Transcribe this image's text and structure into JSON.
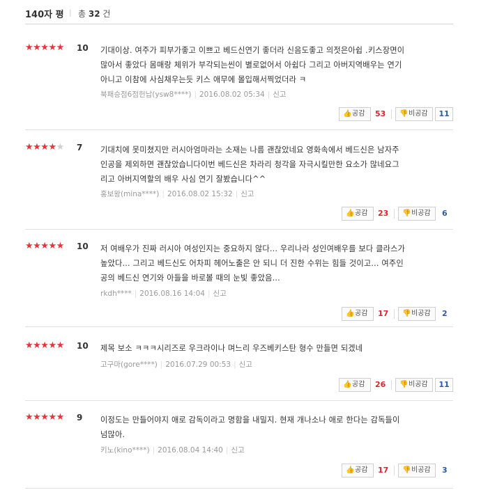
{
  "header": {
    "title": "140자 평",
    "separator": "|",
    "total_prefix": "총",
    "total_count": "32",
    "total_suffix": "건"
  },
  "labels": {
    "like": "공감",
    "dislike": "비공감",
    "report": "신고"
  },
  "reviews": [
    {
      "stars": 5,
      "score": "10",
      "lines": [
        "기대이상. 여주가 피부가좋고 이쁘고 베드신연기 좋더라 신음도좋고 의젓은아쉽 .키스장면이",
        "많아서 좋았다 몸매랑 체위가 부각되는씬이 별로없어서 아쉽다 그리고 아버지역배우는 연기",
        "아니고 이참에 사심채우는듯 키스 애무에 몰입해서찍었더라 ㅋ"
      ],
      "author": "북패승점6점헌납(ysw8****)",
      "date": "2016.08.02 05:34",
      "likes": "53",
      "dislikes": "11"
    },
    {
      "stars": 3.5,
      "score": "7",
      "lines": [
        "기대치에 못미쳤지만 러시아엄마라는 소재는 나름 괜찮았네요 영화속에서 베드신은 남자주",
        "인공을 제외하면 괜찮았습니다이번 베드신은 차라리 청각을 자극시킬만한 요소가 많네요그",
        "리고 아버지역할의 배우 사심 연기 잘봤습니다^^"
      ],
      "author": "홍보왕(mina****)",
      "date": "2016.08.02 15:32",
      "likes": "23",
      "dislikes": "6"
    },
    {
      "stars": 5,
      "score": "10",
      "lines": [
        "저 여배우가 진짜 러시아 여성인지는 중요하지 않다... 우리나라 성인여배우를 보다 클라스가",
        "높았다... 그리고 베드신도 어차피 헤어노출은 안 되니 더 진한 수위는 힘들 것이고... 여주인",
        "공의 베드신 연기와 아들을 바로볼 때의 눈빛 좋았음..."
      ],
      "author": "rkdh****",
      "date": "2016.08.16 14:04",
      "likes": "17",
      "dislikes": "2"
    },
    {
      "stars": 5,
      "score": "10",
      "lines": [
        "제목 보소 ㅋㅋㅋ시리즈로 우크라이나 며느리 우즈베키스탄 형수 만들면 되겠네"
      ],
      "author": "고구마(gore****)",
      "date": "2016.07.29 00:53",
      "likes": "26",
      "dislikes": "11"
    },
    {
      "stars": 4.5,
      "score": "9",
      "lines": [
        "이정도는 만들어야지 애로 감독이라고 명함을 내밀지. 현재 개나소나 애로 한다는 감독들이",
        "넘많아."
      ],
      "author": "키노(kino****)",
      "date": "2016.08.04 14:40",
      "likes": "17",
      "dislikes": "3"
    }
  ],
  "colors": {
    "accent": "#e8333a",
    "count_red": "#d9262c",
    "count_blue": "#2b5aa6"
  },
  "icons": {
    "like": "thumbs-up-icon",
    "dislike": "thumbs-down-icon"
  }
}
